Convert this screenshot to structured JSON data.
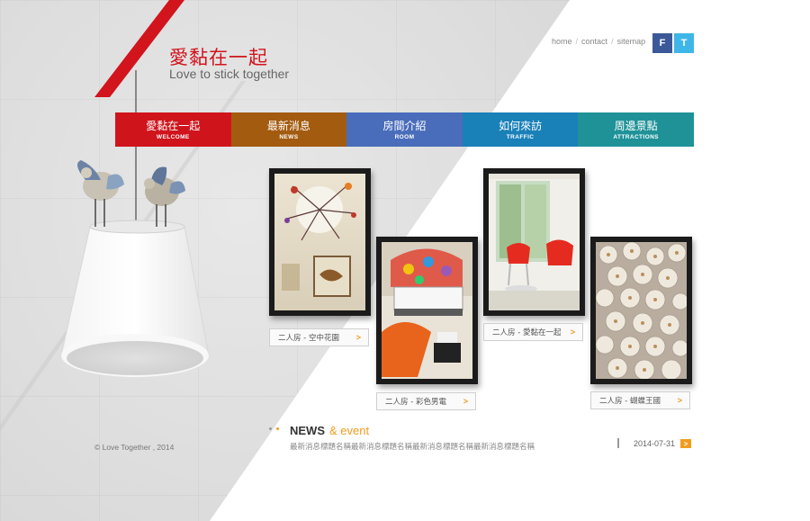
{
  "logo": {
    "title": "愛黏在一起",
    "subtitle": "Love to stick together"
  },
  "top_links": {
    "home": "home",
    "contact": "contact",
    "sitemap": "sitemap",
    "separator": "/"
  },
  "social": {
    "facebook": "F",
    "twitter": "T"
  },
  "nav": [
    {
      "cn": "愛黏在一起",
      "en": "WELCOME",
      "color": "#d0141c"
    },
    {
      "cn": "最新消息",
      "en": "NEWS",
      "color": "#a35b0f"
    },
    {
      "cn": "房間介紹",
      "en": "ROOM",
      "color": "#4a6dbb"
    },
    {
      "cn": "如何來訪",
      "en": "TRAFFIC",
      "color": "#1a80b8"
    },
    {
      "cn": "周邊景點",
      "en": "ATTRACTIONS",
      "color": "#1f9298"
    }
  ],
  "gallery": [
    {
      "caption": "二人房 - 空中花園",
      "arrow": ">"
    },
    {
      "caption": "二人房 - 彩色男電",
      "arrow": ">"
    },
    {
      "caption": "二人房 - 愛黏在一起",
      "arrow": ">"
    },
    {
      "caption": "二人房 - 蝴蝶王國",
      "arrow": ">"
    }
  ],
  "news": {
    "title": "NEWS",
    "subtitle": "& event",
    "headline": "最新消息標題名稱最新消息標題名稱最新消息標題名稱最新消息標題名稱",
    "date": "2014-07-31",
    "more": ">"
  },
  "footer": {
    "copyright": "© Love Together , 2014"
  },
  "colors": {
    "accent_red": "#d2141d",
    "accent_orange": "#f29c1f"
  }
}
